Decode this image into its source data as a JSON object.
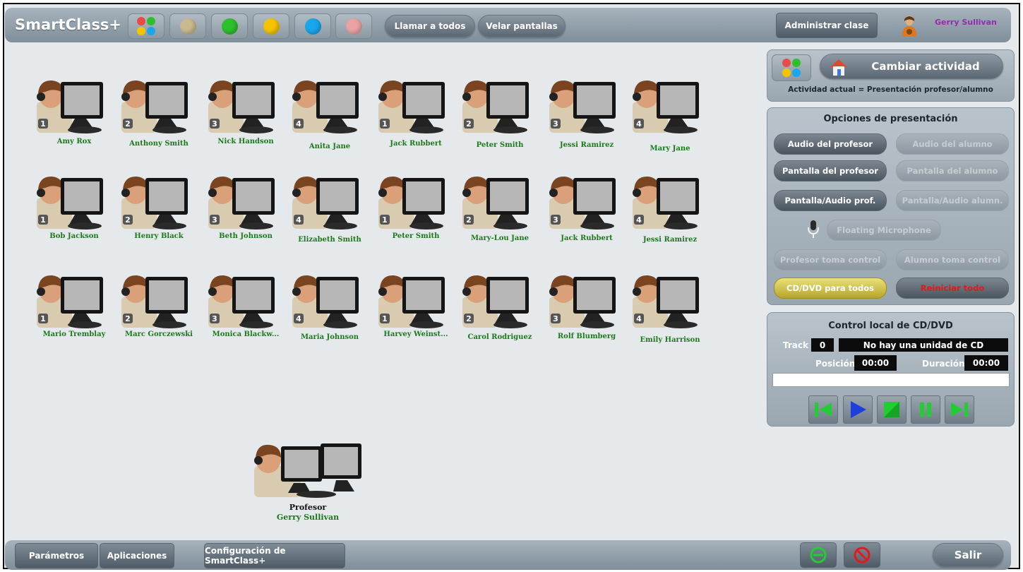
{
  "app": {
    "title": "SmartClass+"
  },
  "header": {
    "call_all": "Llamar a todos",
    "blank_screens": "Velar pantallas",
    "manage_class": "Administrar clase",
    "user_name": "Gerry Sullivan",
    "group_colors": [
      "#c9b98f",
      "#2cc02c",
      "#f5c400",
      "#1aa6ea",
      "#e9a3a3"
    ]
  },
  "students": [
    {
      "name": "Amy Rox",
      "num": "1"
    },
    {
      "name": "Anthony Smith",
      "num": "2"
    },
    {
      "name": "Nick Handson",
      "num": "3"
    },
    {
      "name": "Anita Jane",
      "num": "4"
    },
    {
      "name": "Jack Rubbert",
      "num": "1"
    },
    {
      "name": "Peter Smith",
      "num": "2"
    },
    {
      "name": "Jessi Ramirez",
      "num": "3"
    },
    {
      "name": "Mary Jane",
      "num": "4"
    },
    {
      "name": "Bob Jackson",
      "num": "1"
    },
    {
      "name": "Henry Black",
      "num": "2"
    },
    {
      "name": "Beth Johnson",
      "num": "3"
    },
    {
      "name": "Elizabeth Smith",
      "num": "4"
    },
    {
      "name": "Peter Smith",
      "num": "1"
    },
    {
      "name": "Mary-Lou Jane",
      "num": "2"
    },
    {
      "name": "Jack Rubbert",
      "num": "3"
    },
    {
      "name": "Jessi Ramirez",
      "num": "4"
    },
    {
      "name": "Mario Tremblay",
      "num": "1"
    },
    {
      "name": "Marc Gorczewski",
      "num": "2"
    },
    {
      "name": "Monica Blackw...",
      "num": "3"
    },
    {
      "name": "Maria Johnson",
      "num": "4"
    },
    {
      "name": "Harvey Weinst...",
      "num": "1"
    },
    {
      "name": "Carol Rodriguez",
      "num": "2"
    },
    {
      "name": "Rolf Blumberg",
      "num": "3"
    },
    {
      "name": "Emily Harrison",
      "num": "4"
    }
  ],
  "teacher": {
    "label": "Profesor",
    "name": "Gerry Sullivan"
  },
  "activity": {
    "change_label": "Cambiar actividad",
    "current": "Actividad actual = Presentación profesor/alumno"
  },
  "presentation": {
    "title": "Opciones de presentación",
    "teacher_audio": "Audio del profesor",
    "student_audio": "Audio del alumno",
    "teacher_screen": "Pantalla del profesor",
    "student_screen": "Pantalla del alumno",
    "teacher_screen_audio": "Pantalla/Audio prof.",
    "student_screen_audio": "Pantalla/Audio alumn.",
    "floating_mic": "Floating Microphone",
    "teacher_control": "Profesor toma control",
    "student_control": "Alumno toma control",
    "cd_all": "CD/DVD para todos",
    "reset_all": "Reiniciar todo"
  },
  "cd": {
    "title": "Control local de CD/DVD",
    "track_label": "Track",
    "track_value": "0",
    "status": "No hay una unidad de CD",
    "position_label": "Posición",
    "position_value": "00:00",
    "duration_label": "Duración",
    "duration_value": "00:00"
  },
  "footer": {
    "params": "Parámetros",
    "apps": "Aplicaciones",
    "config": "Configuración de SmartClass+",
    "exit": "Salir"
  }
}
